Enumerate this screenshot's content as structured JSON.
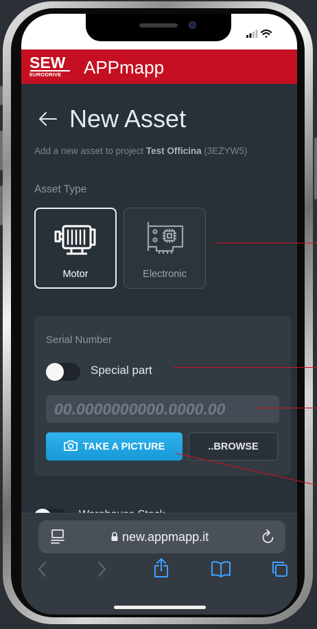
{
  "app": {
    "brand_name": "SEW",
    "brand_sub": "EURODRIVE",
    "name": "APPmapp"
  },
  "page": {
    "title": "New Asset",
    "subtitle_prefix": "Add a new asset to project",
    "project_name": "Test Officina",
    "project_code": "(3EZYW5)"
  },
  "asset_type": {
    "label": "Asset Type",
    "options": [
      {
        "label": "Motor",
        "icon": "motor-icon",
        "selected": true
      },
      {
        "label": "Electronic",
        "icon": "circuit-board-icon",
        "selected": false
      }
    ]
  },
  "serial": {
    "label": "Serial Number",
    "special_part_label": "Special part",
    "special_part_on": false,
    "placeholder": "00.0000000000.0000.00",
    "take_picture_label": "TAKE A PICTURE",
    "browse_label": "..BROWSE"
  },
  "warehouse_stock": {
    "label": "Warehouse Stock",
    "on": false
  },
  "browser": {
    "url": "new.appmapp.it"
  },
  "colors": {
    "brand_red": "#c41022",
    "accent_blue": "#1ea4e4",
    "background": "#283038",
    "panel": "#323a42"
  }
}
